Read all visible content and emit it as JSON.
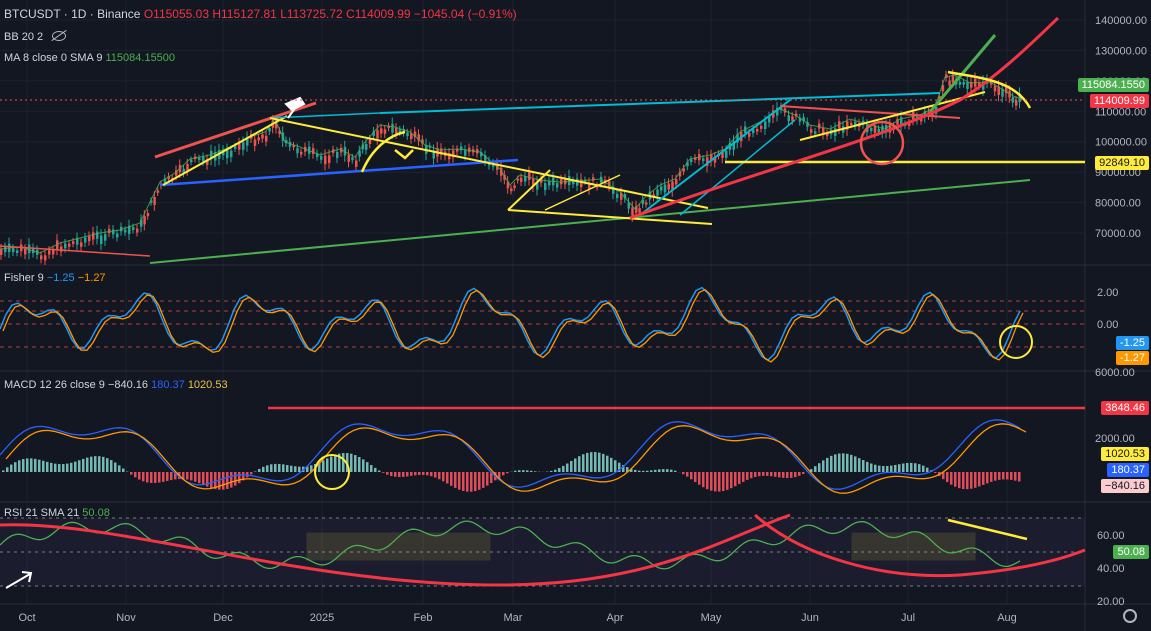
{
  "header": {
    "symbol": "BTCUSDT · 1D · Binance",
    "open": "O115055.03",
    "high": "H115127.81",
    "low": "L113725.72",
    "close": "C114009.99",
    "change": "−1045.04 (−0.91%)",
    "bb_label": "BB 20 2",
    "ma_label": "MA 8 close 0 SMA 9",
    "ma_value": "115084.15500"
  },
  "fisher": {
    "label": "Fisher 9",
    "v1": "−1.25",
    "v2": "−1.27"
  },
  "macd": {
    "label": "MACD 12 26 close 9",
    "hist": "−840.16",
    "macd": "180.37",
    "signal": "1020.53"
  },
  "rsi": {
    "label": "RSI 21 SMA 21",
    "value": "50.08"
  },
  "price_axis": {
    "ticks": [
      "140000.00",
      "130000.00",
      "120000.00",
      "110000.00",
      "100000.00",
      "90000.00",
      "80000.00",
      "70000.00"
    ],
    "tags": [
      {
        "text": "115084.1550",
        "bg": "#4caf50",
        "fg": "#ffffff"
      },
      {
        "text": "114009.99",
        "bg": "#f23645",
        "fg": "#ffffff"
      },
      {
        "text": "92849.10",
        "bg": "#ffeb3b",
        "fg": "#131722"
      }
    ]
  },
  "fisher_axis": {
    "ticks": [
      "2.00",
      "0.00"
    ],
    "tags": [
      {
        "text": "-1.25",
        "bg": "#2196f3",
        "fg": "#ffffff"
      },
      {
        "text": "-1.27",
        "bg": "#ff9800",
        "fg": "#ffffff"
      }
    ]
  },
  "macd_axis": {
    "ticks": [
      "6000.00",
      "2000.00"
    ],
    "tags": [
      {
        "text": "3848.46",
        "bg": "#f23645",
        "fg": "#ffffff"
      },
      {
        "text": "1020.53",
        "bg": "#ffeb3b",
        "fg": "#131722"
      },
      {
        "text": "180.37",
        "bg": "#2962ff",
        "fg": "#ffffff"
      },
      {
        "text": "−840.16",
        "bg": "#fccbcd",
        "fg": "#131722"
      }
    ]
  },
  "rsi_axis": {
    "ticks": [
      "60.00",
      "40.00",
      "20.00"
    ],
    "tags": [
      {
        "text": "50.08",
        "bg": "#4caf50",
        "fg": "#ffffff"
      }
    ]
  },
  "time_axis": [
    "Oct",
    "Nov",
    "Dec",
    "2025",
    "Feb",
    "Mar",
    "Apr",
    "May",
    "Jun",
    "Jul",
    "Aug"
  ],
  "chart_data": {
    "type": "line",
    "x": [
      "2024-10-01",
      "2024-11-01",
      "2024-12-01",
      "2025-01-01",
      "2025-02-01",
      "2025-03-01",
      "2025-04-01",
      "2025-05-01",
      "2025-06-01",
      "2025-07-01",
      "2025-08-01",
      "2025-08-05"
    ],
    "series": [
      {
        "name": "BTCUSDT",
        "values": [
          62000,
          70000,
          97000,
          94000,
          100000,
          84000,
          83000,
          97000,
          105000,
          108000,
          115000,
          114009.99
        ]
      }
    ],
    "ylim": [
      60000,
      145000
    ]
  }
}
